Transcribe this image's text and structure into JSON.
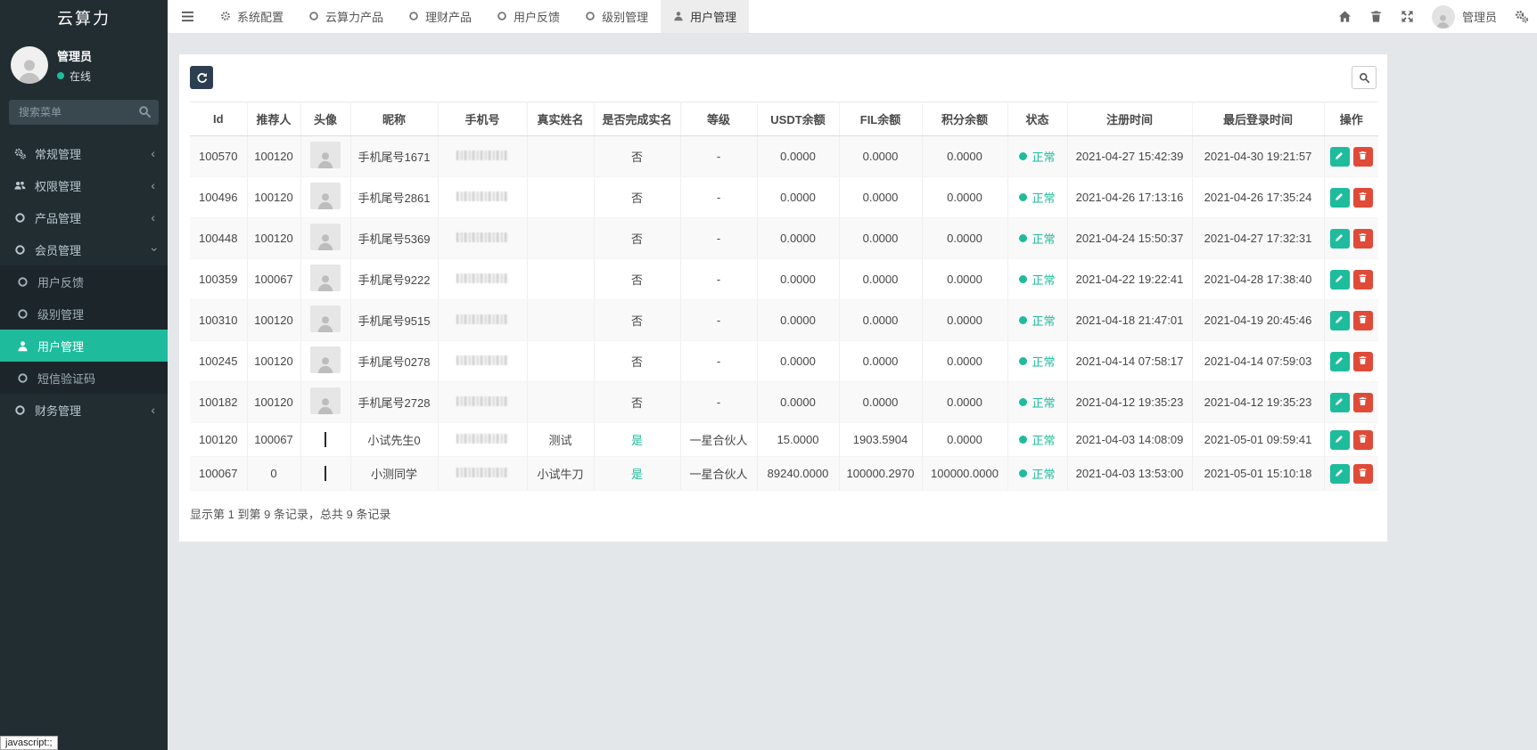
{
  "app": {
    "title": "云算力",
    "statusbar_text": "javascript:;"
  },
  "colors": {
    "accent": "#1ebc9c",
    "danger": "#df4b38",
    "dark_button": "#2d3e50",
    "sidebar_bg": "#222d32"
  },
  "sidebar": {
    "user": {
      "name": "管理员",
      "status": "在线"
    },
    "search_placeholder": "搜索菜单",
    "menu": [
      {
        "label": "常规管理",
        "icon": "gears-icon",
        "state": "collapsed"
      },
      {
        "label": "权限管理",
        "icon": "users-icon",
        "state": "collapsed"
      },
      {
        "label": "产品管理",
        "icon": "circle-icon",
        "state": "collapsed"
      },
      {
        "label": "会员管理",
        "icon": "circle-icon",
        "state": "expanded",
        "children": [
          {
            "label": "用户反馈",
            "icon": "circle-icon",
            "active": false
          },
          {
            "label": "级别管理",
            "icon": "circle-icon",
            "active": false
          },
          {
            "label": "用户管理",
            "icon": "user-icon",
            "active": true
          },
          {
            "label": "短信验证码",
            "icon": "circle-icon",
            "active": false
          }
        ]
      },
      {
        "label": "财务管理",
        "icon": "circle-icon",
        "state": "collapsed"
      }
    ]
  },
  "navbar": {
    "tabs": [
      {
        "label": "系统配置",
        "icon": "gear-icon",
        "active": false
      },
      {
        "label": "云算力产品",
        "icon": "circle-icon",
        "active": false
      },
      {
        "label": "理财产品",
        "icon": "circle-icon",
        "active": false
      },
      {
        "label": "用户反馈",
        "icon": "circle-icon",
        "active": false
      },
      {
        "label": "级别管理",
        "icon": "circle-icon",
        "active": false
      },
      {
        "label": "用户管理",
        "icon": "user-icon",
        "active": true
      }
    ],
    "right_user_label": "管理员"
  },
  "table": {
    "columns": [
      "Id",
      "推荐人",
      "头像",
      "昵称",
      "手机号",
      "真实姓名",
      "是否完成实名",
      "等级",
      "USDT余额",
      "FIL余额",
      "积分余额",
      "状态",
      "注册时间",
      "最后登录时间",
      "操作"
    ],
    "rows": [
      {
        "id": "100570",
        "referrer": "100120",
        "avatar": "placeholder",
        "nickname": "手机尾号1671",
        "phone_redacted": true,
        "realname": "",
        "verified": "否",
        "level": "-",
        "usdt": "0.0000",
        "fil": "0.0000",
        "points": "0.0000",
        "status": "正常",
        "registered": "2021-04-27 15:42:39",
        "last_login": "2021-04-30 19:21:57"
      },
      {
        "id": "100496",
        "referrer": "100120",
        "avatar": "placeholder",
        "nickname": "手机尾号2861",
        "phone_redacted": true,
        "realname": "",
        "verified": "否",
        "level": "-",
        "usdt": "0.0000",
        "fil": "0.0000",
        "points": "0.0000",
        "status": "正常",
        "registered": "2021-04-26 17:13:16",
        "last_login": "2021-04-26 17:35:24"
      },
      {
        "id": "100448",
        "referrer": "100120",
        "avatar": "placeholder",
        "nickname": "手机尾号5369",
        "phone_redacted": true,
        "realname": "",
        "verified": "否",
        "level": "-",
        "usdt": "0.0000",
        "fil": "0.0000",
        "points": "0.0000",
        "status": "正常",
        "registered": "2021-04-24 15:50:37",
        "last_login": "2021-04-27 17:32:31"
      },
      {
        "id": "100359",
        "referrer": "100067",
        "avatar": "placeholder",
        "nickname": "手机尾号9222",
        "phone_redacted": true,
        "realname": "",
        "verified": "否",
        "level": "-",
        "usdt": "0.0000",
        "fil": "0.0000",
        "points": "0.0000",
        "status": "正常",
        "registered": "2021-04-22 19:22:41",
        "last_login": "2021-04-28 17:38:40"
      },
      {
        "id": "100310",
        "referrer": "100120",
        "avatar": "placeholder",
        "nickname": "手机尾号9515",
        "phone_redacted": true,
        "realname": "",
        "verified": "否",
        "level": "-",
        "usdt": "0.0000",
        "fil": "0.0000",
        "points": "0.0000",
        "status": "正常",
        "registered": "2021-04-18 21:47:01",
        "last_login": "2021-04-19 20:45:46"
      },
      {
        "id": "100245",
        "referrer": "100120",
        "avatar": "placeholder",
        "nickname": "手机尾号0278",
        "phone_redacted": true,
        "realname": "",
        "verified": "否",
        "level": "-",
        "usdt": "0.0000",
        "fil": "0.0000",
        "points": "0.0000",
        "status": "正常",
        "registered": "2021-04-14 07:58:17",
        "last_login": "2021-04-14 07:59:03"
      },
      {
        "id": "100182",
        "referrer": "100120",
        "avatar": "placeholder",
        "nickname": "手机尾号2728",
        "phone_redacted": true,
        "realname": "",
        "verified": "否",
        "level": "-",
        "usdt": "0.0000",
        "fil": "0.0000",
        "points": "0.0000",
        "status": "正常",
        "registered": "2021-04-12 19:35:23",
        "last_login": "2021-04-12 19:35:23"
      },
      {
        "id": "100120",
        "referrer": "100067",
        "avatar": "photo",
        "nickname": "小试先生0",
        "phone_redacted": true,
        "realname": "测试",
        "verified": "是",
        "level": "一星合伙人",
        "usdt": "15.0000",
        "fil": "1903.5904",
        "points": "0.0000",
        "status": "正常",
        "registered": "2021-04-03 14:08:09",
        "last_login": "2021-05-01 09:59:41"
      },
      {
        "id": "100067",
        "referrer": "0",
        "avatar": "photo",
        "nickname": "小测同学",
        "phone_redacted": true,
        "realname": "小试牛刀",
        "verified": "是",
        "level": "一星合伙人",
        "usdt": "89240.0000",
        "fil": "100000.2970",
        "points": "100000.0000",
        "status": "正常",
        "registered": "2021-04-03 13:53:00",
        "last_login": "2021-05-01 15:10:18"
      }
    ],
    "summary": "显示第 1 到第 9 条记录，总共 9 条记录"
  }
}
